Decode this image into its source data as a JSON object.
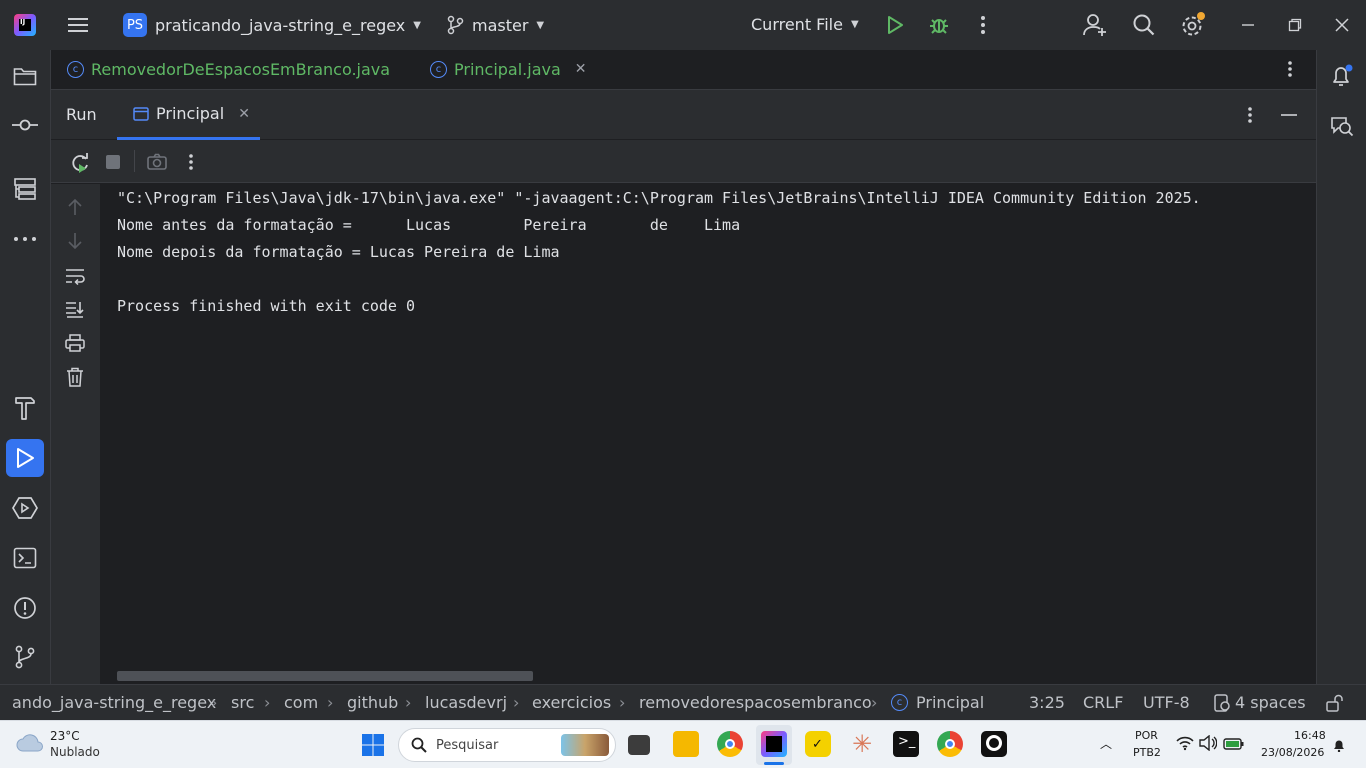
{
  "titlebar": {
    "project_badge": "PS",
    "project_name": "praticando_java-string_e_regex",
    "branch": "master",
    "run_config": "Current File"
  },
  "editor_tabs": [
    {
      "label": "RemovedorDeEspacosEmBranco.java"
    },
    {
      "label": "Principal.java"
    }
  ],
  "run_panel": {
    "title": "Run",
    "tab_label": "Principal"
  },
  "console": {
    "lines": [
      "\"C:\\Program Files\\Java\\jdk-17\\bin\\java.exe\" \"-javaagent:C:\\Program Files\\JetBrains\\IntelliJ IDEA Community Edition 2025.",
      "Nome antes da formatação =      Lucas        Pereira       de    Lima",
      "Nome depois da formatação = Lucas Pereira de Lima",
      "",
      "Process finished with exit code 0"
    ]
  },
  "statusbar": {
    "breadcrumbs": [
      "ando_java-string_e_regex",
      "src",
      "com",
      "github",
      "lucasdevrj",
      "exercicios",
      "removedorespacosembranco",
      "Principal"
    ],
    "position": "3:25",
    "line_ending": "CRLF",
    "encoding": "UTF-8",
    "indent": "4 spaces"
  },
  "taskbar": {
    "weather_temp": "23°C",
    "weather_desc": "Nublado",
    "search_placeholder": "Pesquisar",
    "lang": "POR",
    "layout": "PTB2",
    "time": "16:48",
    "date": "23/08/2026"
  },
  "colors": {
    "accent": "#3574f0",
    "run_green": "#5fb865",
    "tab_file_green": "#5fb865",
    "notif_dot": "#f0a732"
  }
}
